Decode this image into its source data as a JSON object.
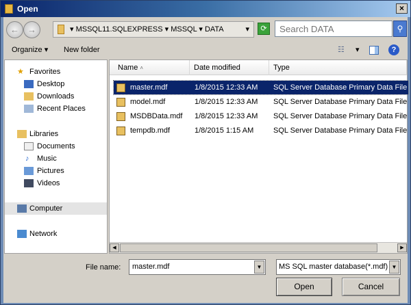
{
  "window": {
    "title": "Open",
    "close": "×"
  },
  "address": {
    "crumbs": [
      "MSSQL11.SQLEXPRESS",
      "MSSQL",
      "DATA"
    ],
    "search_placeholder": "Search DATA"
  },
  "toolbar": {
    "organize": "Organize",
    "new_folder": "New folder"
  },
  "sidebar": {
    "items": [
      {
        "label": "Favorites"
      },
      {
        "label": "Desktop"
      },
      {
        "label": "Downloads"
      },
      {
        "label": "Recent Places"
      },
      {
        "label": "Libraries"
      },
      {
        "label": "Documents"
      },
      {
        "label": "Music"
      },
      {
        "label": "Pictures"
      },
      {
        "label": "Videos"
      },
      {
        "label": "Computer"
      },
      {
        "label": "Network"
      }
    ]
  },
  "columns": [
    "Name",
    "Date modified",
    "Type"
  ],
  "files": [
    {
      "name": "master.mdf",
      "date": "1/8/2015 12:33 AM",
      "type": "SQL Server Database Primary Data File"
    },
    {
      "name": "model.mdf",
      "date": "1/8/2015 12:33 AM",
      "type": "SQL Server Database Primary Data File"
    },
    {
      "name": "MSDBData.mdf",
      "date": "1/8/2015 12:33 AM",
      "type": "SQL Server Database Primary Data File"
    },
    {
      "name": "tempdb.mdf",
      "date": "1/8/2015 1:15 AM",
      "type": "SQL Server Database Primary Data File"
    }
  ],
  "bottom": {
    "file_name_label": "File name:",
    "file_name_value": "master.mdf",
    "filter": "MS SQL master database(*.mdf)",
    "open": "Open",
    "cancel": "Cancel"
  }
}
